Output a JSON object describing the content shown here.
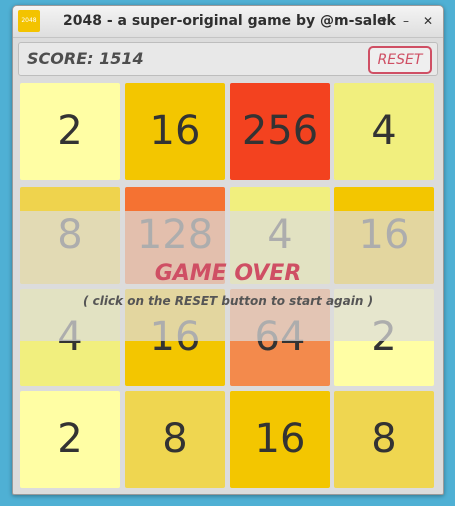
{
  "window": {
    "app_icon_text": "2048",
    "title": "2048 - a super-original game by @m-salek",
    "buttons": {
      "up": "🠩",
      "minimize": "–",
      "close": "✕"
    }
  },
  "toolbar": {
    "score_label": "SCORE: 1514",
    "reset_label": "RESET"
  },
  "board": {
    "rows": [
      [
        "2",
        "16",
        "256",
        "4"
      ],
      [
        "8",
        "128",
        "4",
        "16"
      ],
      [
        "4",
        "16",
        "64",
        "2"
      ],
      [
        "2",
        "8",
        "16",
        "8"
      ]
    ],
    "colors": [
      [
        "#fffea4",
        "#f3c600",
        "#f3421f",
        "#f1ef7e"
      ],
      [
        "#efd34d",
        "#f57232",
        "#f1ef7e",
        "#f3c600"
      ],
      [
        "#f1ef7e",
        "#f3c600",
        "#f38a4c",
        "#fffea4"
      ],
      [
        "#fffea4",
        "#efd650",
        "#f3c600",
        "#efd650"
      ]
    ]
  },
  "game_over": {
    "title": "GAME OVER",
    "subtitle": "( click on the RESET button to start again )"
  }
}
